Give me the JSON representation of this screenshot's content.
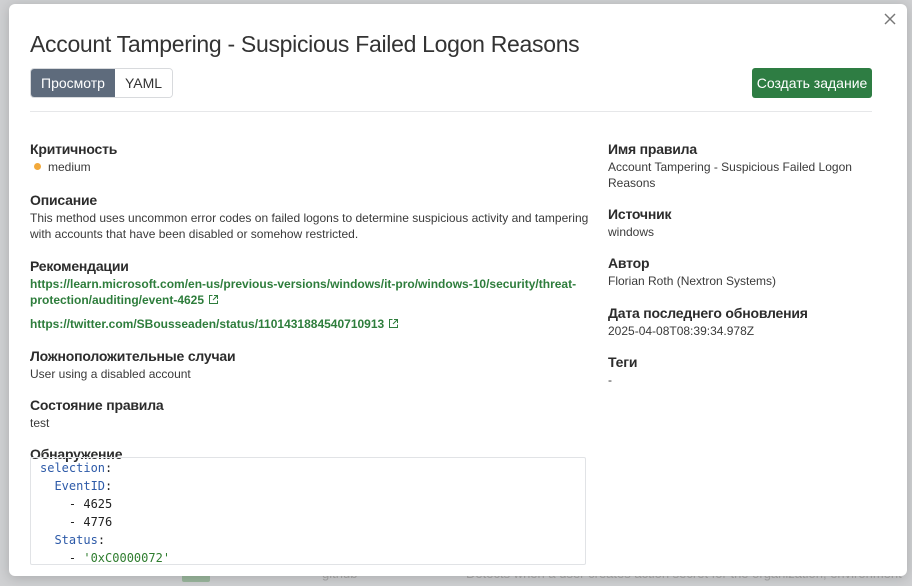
{
  "modal": {
    "title": "Account Tampering - Suspicious Failed Logon Reasons",
    "tabs": [
      "Просмотр",
      "YAML"
    ],
    "create_task_label": "Создать задание"
  },
  "left": {
    "severity": {
      "title": "Критичность",
      "value": "medium",
      "color": "#f2a93b"
    },
    "description": {
      "title": "Описание",
      "line1": "This method uses uncommon error codes on failed logons to determine suspicious activity and tampering",
      "line2": "with accounts that have been disabled or somehow restricted."
    },
    "references": {
      "title": "Рекомендации",
      "link1_line1": "https://learn.microsoft.com/en-us/previous-versions/windows/it-pro/windows-10/security/threat-",
      "link1_line2": "protection/auditing/event-4625",
      "link2": "https://twitter.com/SBousseaden/status/1101431884540710913"
    },
    "false_positives": {
      "title": "Ложноположительные случаи",
      "value": "User using a disabled account"
    },
    "status": {
      "title": "Состояние правила",
      "value": "test"
    },
    "detection": {
      "title": "Обнаружение",
      "lines": [
        {
          "indent": "",
          "key": "selection",
          "rest": ":"
        },
        {
          "indent": "  ",
          "key": "EventID",
          "rest": ":"
        },
        {
          "indent": "    ",
          "key": "",
          "rest": "- 4625"
        },
        {
          "indent": "    ",
          "key": "",
          "rest": "- 4776"
        },
        {
          "indent": "  ",
          "key": "Status",
          "rest": ":"
        },
        {
          "indent": "    ",
          "key": "",
          "rest": "- ",
          "str": "'0xC0000072'"
        }
      ]
    }
  },
  "right": {
    "rule_name": {
      "title": "Имя правила",
      "value": "Account Tampering - Suspicious Failed Logon Reasons"
    },
    "source": {
      "title": "Источник",
      "value": "windows"
    },
    "author": {
      "title": "Автор",
      "value": "Florian Roth (Nextron Systems)"
    },
    "updated": {
      "title": "Дата последнего обновления",
      "value": "2025-04-08T08:39:34.978Z"
    },
    "tags": {
      "title": "Теги",
      "value": "-"
    }
  },
  "background": {
    "row_text1": "github",
    "row_text2": "Detects when a user creates action secret for the organization, environment"
  },
  "colors": {
    "accent": "#2e7d43",
    "active_tab": "#5e6b7c",
    "link": "#2e7d3c"
  }
}
